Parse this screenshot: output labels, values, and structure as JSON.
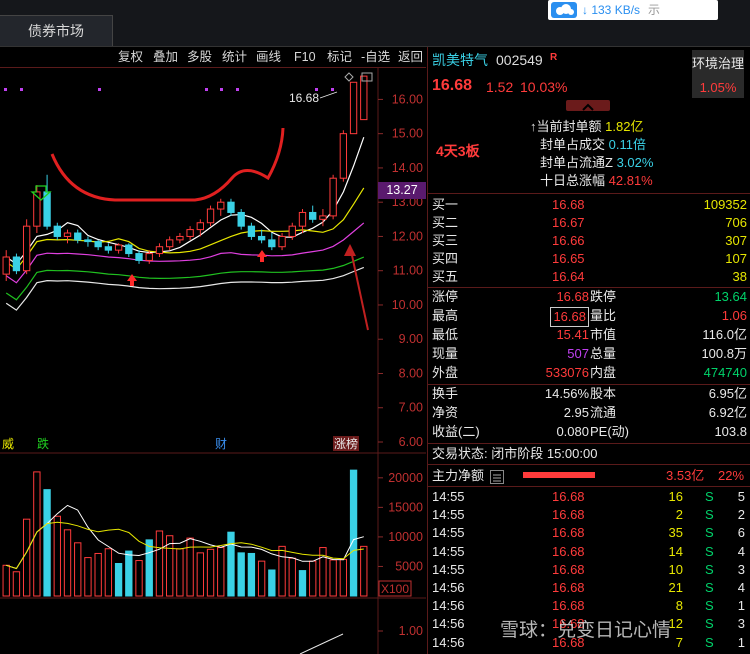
{
  "tabs": {
    "bond_market": "债券市场"
  },
  "net_speed": {
    "value": "↓ 133 KB/s",
    "extra": "示"
  },
  "toolbar": [
    {
      "label": "复权",
      "name": "toolbar-fuquan"
    },
    {
      "label": "叠加",
      "name": "toolbar-diejia"
    },
    {
      "label": "多股",
      "name": "toolbar-duogu"
    },
    {
      "label": "统计",
      "name": "toolbar-tongji"
    },
    {
      "label": "画线",
      "name": "toolbar-huaxian"
    },
    {
      "label": "F10",
      "name": "toolbar-f10"
    },
    {
      "label": "标记",
      "name": "toolbar-biaoji"
    },
    {
      "label": "-自选",
      "name": "toolbar-zixuan"
    },
    {
      "label": "返回",
      "name": "toolbar-fanhui"
    }
  ],
  "chart": {
    "price_axis": [
      "16.00",
      "15.00",
      "14.00",
      "13.00",
      "12.00",
      "11.00",
      "10.00",
      "9.00",
      "8.00",
      "7.00",
      "6.00"
    ],
    "current_price_tag": "13.27",
    "high_label": "16.68",
    "event_labels": {
      "wei": "威",
      "die": "跌",
      "cai": "财",
      "zhangbang": "涨榜"
    },
    "volume_axis": [
      "20000",
      "15000",
      "10000",
      "5000"
    ],
    "volume_unit": "X100",
    "macd_axis": "1.00"
  },
  "chart_data": {
    "type": "candlestick",
    "title": "",
    "ylim": [
      6,
      16.8
    ],
    "volume_ylim": [
      0,
      22000
    ],
    "candles": [
      [
        10.9,
        11.6,
        10.7,
        11.4
      ],
      [
        11.4,
        11.5,
        10.9,
        11.0
      ],
      [
        11.0,
        12.5,
        10.9,
        12.3
      ],
      [
        12.3,
        13.5,
        12.1,
        13.3
      ],
      [
        13.3,
        13.8,
        12.2,
        12.3
      ],
      [
        12.3,
        12.4,
        11.9,
        12.0
      ],
      [
        12.0,
        12.2,
        11.8,
        12.1
      ],
      [
        12.1,
        12.2,
        11.8,
        11.9
      ],
      [
        11.9,
        12.0,
        11.7,
        11.85
      ],
      [
        11.85,
        11.9,
        11.6,
        11.7
      ],
      [
        11.7,
        11.8,
        11.5,
        11.6
      ],
      [
        11.6,
        11.8,
        11.5,
        11.75
      ],
      [
        11.75,
        11.8,
        11.4,
        11.5
      ],
      [
        11.5,
        11.6,
        11.2,
        11.3
      ],
      [
        11.3,
        11.6,
        11.2,
        11.5
      ],
      [
        11.5,
        11.8,
        11.4,
        11.7
      ],
      [
        11.7,
        12.0,
        11.6,
        11.9
      ],
      [
        11.9,
        12.1,
        11.8,
        12.0
      ],
      [
        12.0,
        12.3,
        11.9,
        12.2
      ],
      [
        12.2,
        12.5,
        12.0,
        12.4
      ],
      [
        12.4,
        12.9,
        12.3,
        12.8
      ],
      [
        12.8,
        13.1,
        12.6,
        13.0
      ],
      [
        13.0,
        13.1,
        12.6,
        12.7
      ],
      [
        12.7,
        12.8,
        12.2,
        12.3
      ],
      [
        12.3,
        12.4,
        11.9,
        12.0
      ],
      [
        12.0,
        12.2,
        11.8,
        11.9
      ],
      [
        11.9,
        12.1,
        11.6,
        11.7
      ],
      [
        11.7,
        12.1,
        11.6,
        12.0
      ],
      [
        12.0,
        12.4,
        11.9,
        12.3
      ],
      [
        12.3,
        12.8,
        12.1,
        12.7
      ],
      [
        12.7,
        12.9,
        12.4,
        12.5
      ],
      [
        12.5,
        12.8,
        12.3,
        12.6
      ],
      [
        12.6,
        13.8,
        12.5,
        13.7
      ],
      [
        13.7,
        15.1,
        13.6,
        15.0
      ],
      [
        15.0,
        16.5,
        15.0,
        16.5
      ],
      [
        15.41,
        16.68,
        15.41,
        16.68
      ]
    ],
    "volumes": [
      5200,
      4100,
      13000,
      21000,
      18000,
      13500,
      11200,
      9000,
      6500,
      7200,
      8000,
      5500,
      7600,
      6000,
      9500,
      11000,
      10200,
      8000,
      9800,
      7300,
      7900,
      8200,
      10800,
      7300,
      7200,
      5900,
      4400,
      8400,
      6400,
      4300,
      5900,
      8200,
      6100,
      6200,
      21300,
      8400
    ],
    "vol_colors": [
      "r",
      "r",
      "r",
      "r",
      "c",
      "r",
      "r",
      "r",
      "r",
      "r",
      "r",
      "c",
      "c",
      "r",
      "c",
      "r",
      "r",
      "r",
      "r",
      "r",
      "r",
      "r",
      "c",
      "c",
      "c",
      "r",
      "c",
      "r",
      "r",
      "c",
      "r",
      "r",
      "r",
      "r",
      "c",
      "r"
    ],
    "series": [
      {
        "name": "MA5",
        "color": "#ffffff"
      },
      {
        "name": "MA10",
        "color": "#e6e600"
      },
      {
        "name": "MA20",
        "color": "#e040e0"
      },
      {
        "name": "MA60",
        "color": "#20c020"
      },
      {
        "name": "MA120",
        "color": "#e8e8e8"
      }
    ]
  },
  "stock": {
    "name": "凯美特气",
    "code": "002549",
    "flag": "R",
    "price": "16.68",
    "change": "1.52",
    "change_pct": "10.03%",
    "theme_btn": "环境治理",
    "theme_pct": "1.05%",
    "streak": "4天3板",
    "seal_amount_label": "当前封单额",
    "seal_amount": "1.82亿",
    "seal_deal_label": "封单占成交",
    "seal_deal": "0.11倍",
    "seal_float_label": "封单占流通Z",
    "seal_float": "3.02%",
    "ten_day_label": "十日总涨幅",
    "ten_day": "42.81%"
  },
  "order_book": [
    {
      "label": "买一",
      "price": "16.68",
      "vol": "109352"
    },
    {
      "label": "买二",
      "price": "16.67",
      "vol": "706"
    },
    {
      "label": "买三",
      "price": "16.66",
      "vol": "307"
    },
    {
      "label": "买四",
      "price": "16.65",
      "vol": "107"
    },
    {
      "label": "买五",
      "price": "16.64",
      "vol": "38"
    }
  ],
  "quote": [
    {
      "l1": "涨停",
      "v1": "16.68",
      "l2": "跌停",
      "v2": "13.64",
      "c1": "red",
      "c2": "green"
    },
    {
      "l1": "最高",
      "v1": "16.68",
      "l2": "量比",
      "v2": "1.06",
      "c1": "red",
      "c2": "red"
    },
    {
      "l1": "最低",
      "v1": "15.41",
      "l2": "市值",
      "v2": "116.0亿",
      "c1": "red",
      "c2": "white"
    },
    {
      "l1": "现量",
      "v1": "507",
      "l2": "总量",
      "v2": "100.8万",
      "c1": "purple",
      "c2": "white"
    },
    {
      "l1": "外盘",
      "v1": "533076",
      "l2": "内盘",
      "v2": "474740",
      "c1": "red",
      "c2": "green"
    }
  ],
  "fundamentals": [
    {
      "l1": "换手",
      "v1": "14.56%",
      "l2": "股本",
      "v2": "6.95亿"
    },
    {
      "l1": "净资",
      "v1": "2.95",
      "l2": "流通",
      "v2": "6.92亿"
    },
    {
      "l1": "收益(二)",
      "v1": "0.080",
      "l2": "PE(动)",
      "v2": "103.8"
    }
  ],
  "trade_status": "交易状态: 闭市阶段 15:00:00",
  "main_flow": {
    "label": "主力净额",
    "value": "3.53亿",
    "pct": "22%"
  },
  "ticks": [
    {
      "t": "14:55",
      "p": "16.68",
      "v": "16",
      "s": "S",
      "n": "5"
    },
    {
      "t": "14:55",
      "p": "16.68",
      "v": "2",
      "s": "S",
      "n": "2"
    },
    {
      "t": "14:55",
      "p": "16.68",
      "v": "35",
      "s": "S",
      "n": "6"
    },
    {
      "t": "14:55",
      "p": "16.68",
      "v": "14",
      "s": "S",
      "n": "4"
    },
    {
      "t": "14:55",
      "p": "16.68",
      "v": "10",
      "s": "S",
      "n": "3"
    },
    {
      "t": "14:56",
      "p": "16.68",
      "v": "21",
      "s": "S",
      "n": "4"
    },
    {
      "t": "14:56",
      "p": "16.68",
      "v": "8",
      "s": "S",
      "n": "1"
    },
    {
      "t": "14:56",
      "p": "16.68",
      "v": "12",
      "s": "S",
      "n": "3"
    },
    {
      "t": "14:56",
      "p": "16.68",
      "v": "7",
      "s": "S",
      "n": "1"
    }
  ],
  "watermark": "雪球：兑变日记心情"
}
